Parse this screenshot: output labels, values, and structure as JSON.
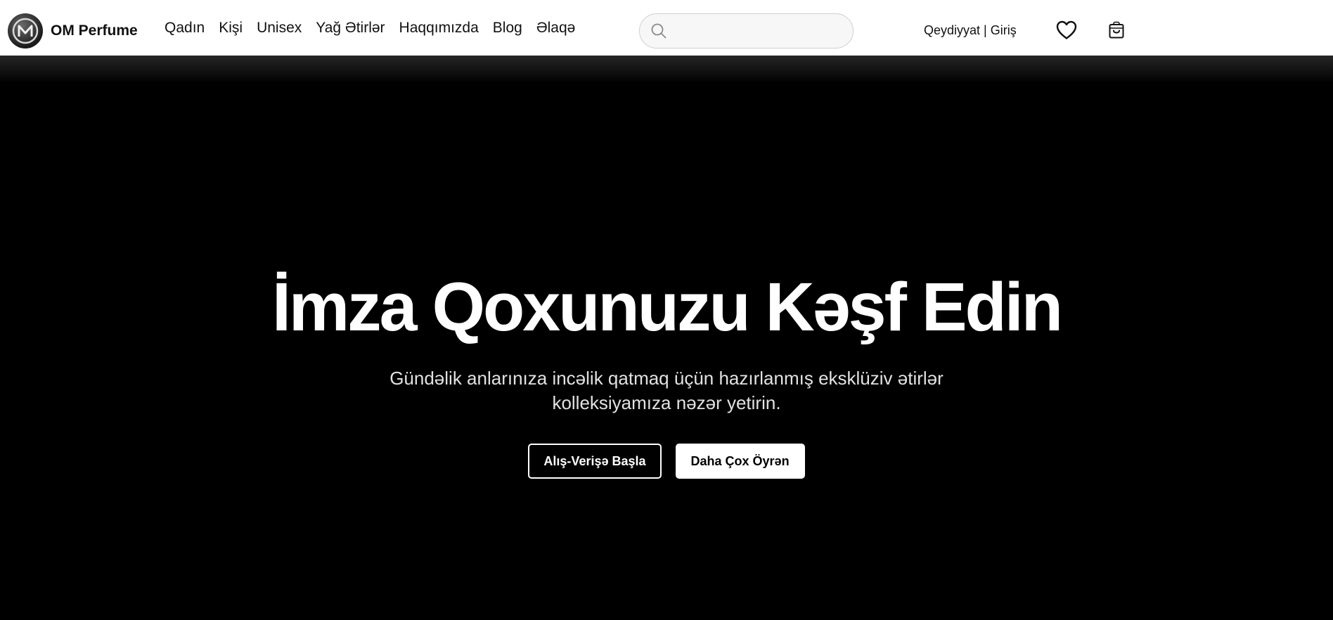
{
  "brand": {
    "name": "OM Perfume",
    "logo_icon": "om-monogram-logo"
  },
  "nav": {
    "links": [
      "Qadın",
      "Kişi",
      "Unisex",
      "Yağ Ətirlər",
      "Haqqımızda",
      "Blog",
      "Əlaqə"
    ]
  },
  "search": {
    "placeholder": "",
    "value": "",
    "icon": "search-icon"
  },
  "auth": {
    "register": "Qeydiyyat",
    "separator": "|",
    "login": "Giriş"
  },
  "actions": {
    "wishlist_icon": "heart-icon",
    "cart_icon": "shopping-bag-icon"
  },
  "hero": {
    "title": "İmza Qoxunuzu Kəşf Edin",
    "subtitle": "Gündəlik anlarınıza incəlik qatmaq üçün hazırlanmış eksklüziv ətirlər kolleksiyamıza nəzər yetirin.",
    "primary_button": "Alış-Verişə Başla",
    "secondary_button": "Daha Çox Öyrən"
  },
  "colors": {
    "navbar_bg": "#ffffff",
    "hero_bg": "#000000",
    "text_dark": "#111111",
    "text_light": "#ffffff"
  }
}
